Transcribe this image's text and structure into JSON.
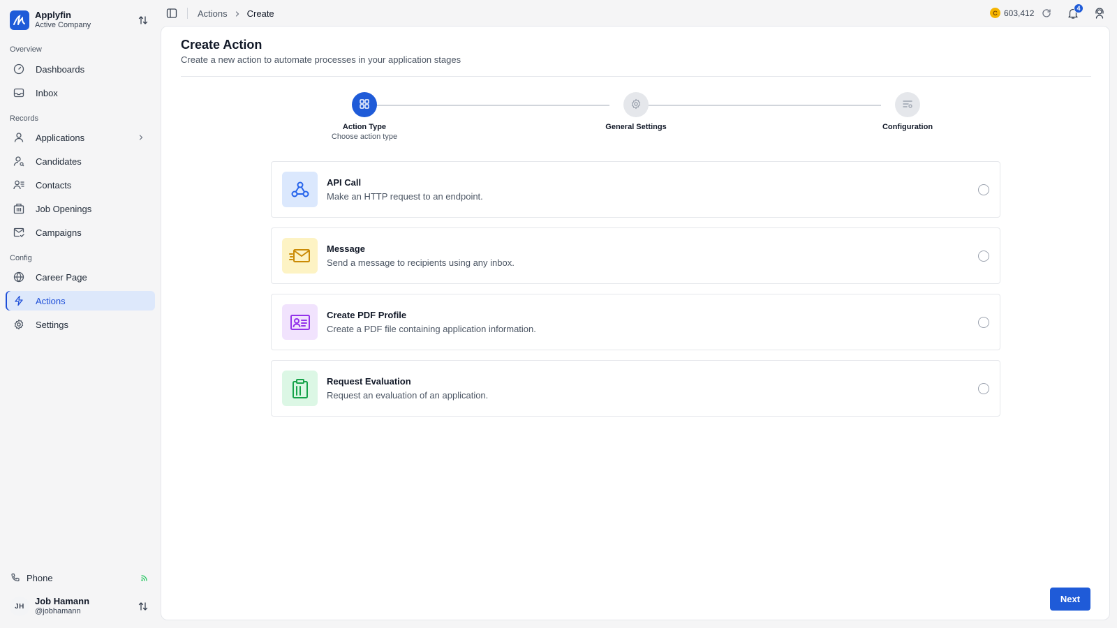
{
  "org": {
    "name": "Applyfin",
    "subtitle": "Active Company"
  },
  "sidebar": {
    "sections": [
      {
        "label": "Overview"
      },
      {
        "label": "Records"
      },
      {
        "label": "Config"
      }
    ],
    "items": [
      {
        "label": "Dashboards",
        "icon": "dashboard-gauge-icon"
      },
      {
        "label": "Inbox",
        "icon": "inbox-icon"
      },
      {
        "label": "Applications",
        "icon": "user-icon",
        "has_submenu": true
      },
      {
        "label": "Candidates",
        "icon": "user-search-icon"
      },
      {
        "label": "Contacts",
        "icon": "contacts-icon"
      },
      {
        "label": "Job Openings",
        "icon": "building-icon"
      },
      {
        "label": "Campaigns",
        "icon": "mail-check-icon"
      },
      {
        "label": "Career Page",
        "icon": "globe-icon"
      },
      {
        "label": "Actions",
        "icon": "bolt-icon",
        "active": true
      },
      {
        "label": "Settings",
        "icon": "gear-icon"
      }
    ],
    "phone": {
      "label": "Phone",
      "icon": "phone-icon",
      "status_color": "#22c55e"
    },
    "user": {
      "initials": "JH",
      "name": "Job Hamann",
      "handle": "@jobhamann"
    }
  },
  "topbar": {
    "breadcrumb": [
      "Actions",
      "Create"
    ],
    "credits": {
      "coin_letter": "C",
      "value": "603,412"
    },
    "notifications_count": "4"
  },
  "page": {
    "title": "Create Action",
    "subtitle": "Create a new action to automate processes in your application stages"
  },
  "stepper": {
    "steps": [
      {
        "label": "Action Type",
        "description": "Choose action type",
        "state": "current",
        "icon": "grid-icon"
      },
      {
        "label": "General Settings",
        "description": "",
        "state": "pending",
        "icon": "gear-icon"
      },
      {
        "label": "Configuration",
        "description": "",
        "state": "pending",
        "icon": "sliders-icon"
      }
    ]
  },
  "options": [
    {
      "title": "API Call",
      "description": "Make an HTTP request to an endpoint.",
      "icon": "webhook-icon",
      "accent": "#2563eb",
      "icon_bg": "#dbe8fd",
      "selected": false
    },
    {
      "title": "Message",
      "description": "Send a message to recipients using any inbox.",
      "icon": "mail-send-icon",
      "accent": "#ca8a04",
      "icon_bg": "#fdf3c4",
      "selected": false
    },
    {
      "title": "Create PDF Profile",
      "description": "Create a PDF file containing application information.",
      "icon": "id-card-icon",
      "accent": "#9333ea",
      "icon_bg": "#f1e3fd",
      "selected": false
    },
    {
      "title": "Request Evaluation",
      "description": "Request an evaluation of an application.",
      "icon": "clipboard-icon",
      "accent": "#16a34a",
      "icon_bg": "#dcf7e5",
      "selected": false
    }
  ],
  "actions": {
    "next_label": "Next"
  },
  "colors": {
    "primary": "#1f5bd8",
    "active_bg": "#dde8fb",
    "coin": "#f5b400"
  }
}
